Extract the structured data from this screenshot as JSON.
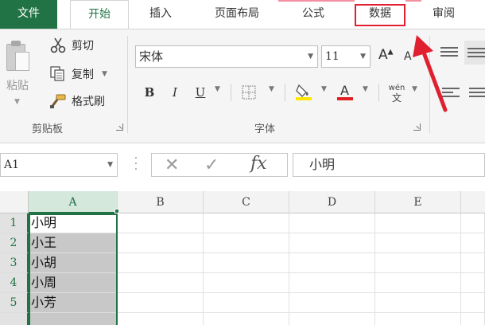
{
  "tabs": {
    "file": "文件",
    "home": "开始",
    "insert": "插入",
    "page_layout": "页面布局",
    "formulas": "公式",
    "data": "数据",
    "review": "审阅"
  },
  "clipboard": {
    "paste": "粘贴",
    "cut": "剪切",
    "copy": "复制",
    "format_painter": "格式刷",
    "group_label": "剪贴板"
  },
  "font": {
    "name": "宋体",
    "size": "11",
    "bold": "B",
    "italic": "I",
    "underline": "U",
    "grow": "A",
    "shrink": "A",
    "phonetic_top": "wén",
    "phonetic_bottom": "文",
    "group_label": "字体"
  },
  "formula_bar": {
    "name_box": "A1",
    "fx": "fx",
    "content": "小明"
  },
  "grid": {
    "columns": [
      "A",
      "B",
      "C",
      "D",
      "E"
    ],
    "rows": [
      "1",
      "2",
      "3",
      "4",
      "5"
    ],
    "cells_a": [
      "小明",
      "小王",
      "小胡",
      "小周",
      "小芳"
    ]
  },
  "colors": {
    "accent": "#217346",
    "annotation_red": "#e02030"
  },
  "icons": [
    "paste-icon",
    "scissors-icon",
    "copy-icon",
    "format-painter-icon",
    "borders-icon",
    "fill-color-icon",
    "font-color-icon",
    "phonetic-icon",
    "cancel-icon",
    "enter-icon",
    "insert-function-icon"
  ]
}
